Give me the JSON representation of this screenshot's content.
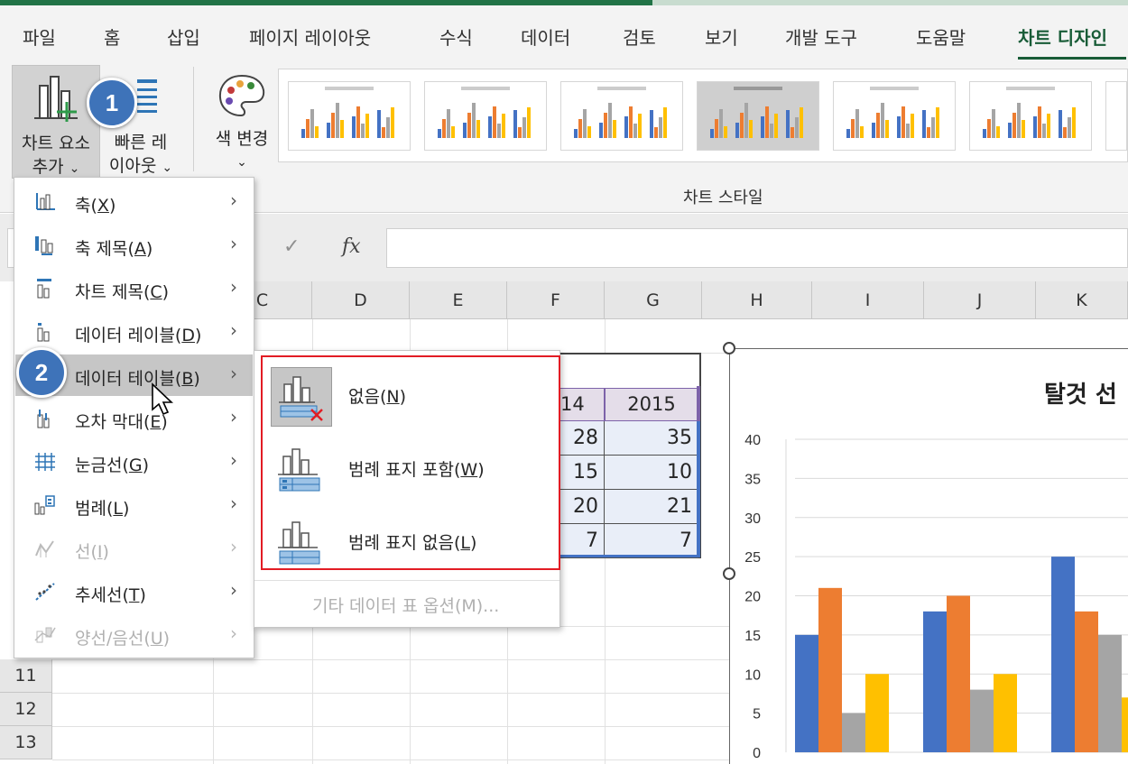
{
  "tabs": [
    "파일",
    "홈",
    "삽입",
    "페이지 레이아웃",
    "수식",
    "데이터",
    "검토",
    "보기",
    "개발 도구",
    "도움말",
    "차트 디자인"
  ],
  "ribbon": {
    "add_element_line1": "차트 요소",
    "add_element_line2": "추가",
    "quick_layout_line1": "빠른 레",
    "quick_layout_line2": "이아웃",
    "change_color": "색 변경",
    "group_label": "차트 스타일",
    "dropdown_glyph": "⌄"
  },
  "badges": [
    "1",
    "2"
  ],
  "formula_bar": {
    "check": "✓",
    "fx": "fx"
  },
  "columns": [
    "C",
    "D",
    "E",
    "F",
    "G",
    "H",
    "I",
    "J",
    "K"
  ],
  "rows": [
    "11",
    "12",
    "13"
  ],
  "chart_element_menu": [
    {
      "label": "축",
      "key": "X",
      "icon": "axis-icon"
    },
    {
      "label": "축 제목",
      "key": "A",
      "icon": "axis-title-icon"
    },
    {
      "label": "차트 제목",
      "key": "C",
      "icon": "chart-title-icon"
    },
    {
      "label": "데이터 레이블",
      "key": "D",
      "icon": "data-label-icon"
    },
    {
      "label": "데이터 테이블",
      "key": "B",
      "icon": "data-table-icon"
    },
    {
      "label": "오차 막대",
      "key": "E",
      "icon": "error-bar-icon"
    },
    {
      "label": "눈금선",
      "key": "G",
      "icon": "gridlines-icon"
    },
    {
      "label": "범례",
      "key": "L",
      "icon": "legend-icon"
    },
    {
      "label": "선",
      "key": "I",
      "icon": "lines-icon"
    },
    {
      "label": "추세선",
      "key": "T",
      "icon": "trendline-icon"
    },
    {
      "label": "양선/음선",
      "key": "U",
      "icon": "up-down-bars-icon"
    }
  ],
  "data_table_submenu": {
    "items": [
      {
        "label": "없음",
        "key": "N"
      },
      {
        "label": "범례 표지 포함",
        "key": "W"
      },
      {
        "label": "범례 표지 없음",
        "key": "L"
      }
    ],
    "more_options": "기타 데이터 표 옵션(M)..."
  },
  "sheet_table": {
    "headers": [
      "14",
      "2015"
    ],
    "rows": [
      [
        "28",
        "35"
      ],
      [
        "15",
        "10"
      ],
      [
        "20",
        "21"
      ],
      [
        "7",
        "7"
      ]
    ]
  },
  "chart_data": {
    "type": "bar",
    "title": "탈것 선",
    "ylim": [
      0,
      40
    ],
    "yticks": [
      "40",
      "35",
      "30",
      "25",
      "20",
      "15",
      "10",
      "5",
      "0"
    ],
    "series": [
      {
        "color": "#4472c4",
        "values": [
          15,
          18,
          25
        ]
      },
      {
        "color": "#ed7d31",
        "values": [
          21,
          20,
          18
        ]
      },
      {
        "color": "#a5a5a5",
        "values": [
          5,
          8,
          15
        ]
      },
      {
        "color": "#ffc000",
        "values": [
          10,
          10,
          7
        ]
      }
    ],
    "grid": true
  },
  "colors": {
    "accent": "#217346",
    "highlight_red": "#e21c24",
    "badge": "#3e73b9"
  }
}
